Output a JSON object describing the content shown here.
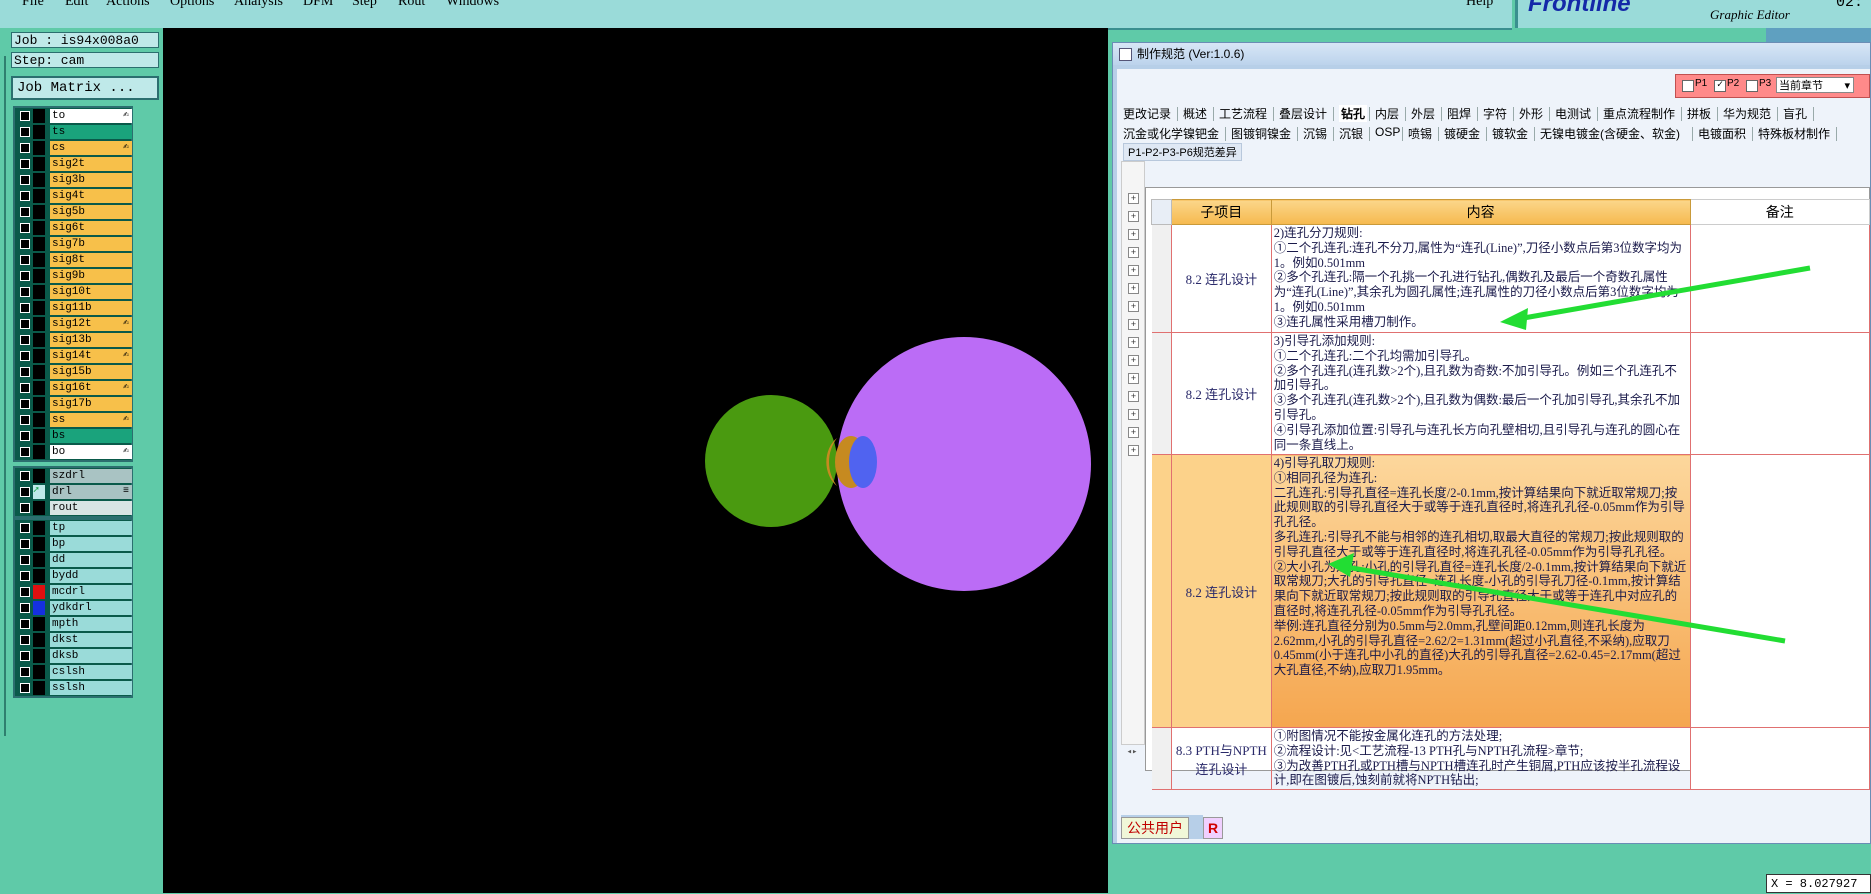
{
  "menu": [
    "File",
    "Edit",
    "Actions",
    "Options",
    "Analysis",
    "DFM",
    "Step",
    "Rout",
    "Windows",
    "Help"
  ],
  "brand": {
    "logo_text": "Frontline",
    "subtitle": "Graphic Editor",
    "clock": "02:"
  },
  "job": {
    "job_label": "Job : is94x008a0",
    "step_label": "Step: cam",
    "matrix_button": "Job Matrix ..."
  },
  "layers_group1": [
    {
      "name": "to",
      "color": "#ffffff",
      "mark": "✍"
    },
    {
      "name": "ts",
      "color": "#1aa37c",
      "mark": ""
    },
    {
      "name": "cs",
      "color": "#f7c04a",
      "mark": "✍"
    },
    {
      "name": "sig2t",
      "color": "#f7c04a",
      "mark": ""
    },
    {
      "name": "sig3b",
      "color": "#f7c04a",
      "mark": ""
    },
    {
      "name": "sig4t",
      "color": "#f7c04a",
      "mark": ""
    },
    {
      "name": "sig5b",
      "color": "#f7c04a",
      "mark": ""
    },
    {
      "name": "sig6t",
      "color": "#f7c04a",
      "mark": ""
    },
    {
      "name": "sig7b",
      "color": "#f7c04a",
      "mark": ""
    },
    {
      "name": "sig8t",
      "color": "#f7c04a",
      "mark": ""
    },
    {
      "name": "sig9b",
      "color": "#f7c04a",
      "mark": ""
    },
    {
      "name": "sig10t",
      "color": "#f7c04a",
      "mark": ""
    },
    {
      "name": "sig11b",
      "color": "#f7c04a",
      "mark": ""
    },
    {
      "name": "sig12t",
      "color": "#f7c04a",
      "mark": "✍"
    },
    {
      "name": "sig13b",
      "color": "#f7c04a",
      "mark": ""
    },
    {
      "name": "sig14t",
      "color": "#f7c04a",
      "mark": "✍"
    },
    {
      "name": "sig15b",
      "color": "#f7c04a",
      "mark": ""
    },
    {
      "name": "sig16t",
      "color": "#f7c04a",
      "mark": "✍"
    },
    {
      "name": "sig17b",
      "color": "#f7c04a",
      "mark": ""
    },
    {
      "name": "ss",
      "color": "#f7c04a",
      "mark": "✍"
    },
    {
      "name": "bs",
      "color": "#1aa37c",
      "mark": ""
    },
    {
      "name": "bo",
      "color": "#ffffff",
      "mark": "✍"
    }
  ],
  "layers_group2": [
    {
      "name": "szdrl",
      "color": "#a9c3c3",
      "mark": ""
    },
    {
      "name": "drl",
      "color": "#a9c3c3",
      "mark": "≡"
    },
    {
      "name": "rout",
      "color": "#d8e4e4",
      "mark": ""
    }
  ],
  "layers_group3": [
    {
      "name": "tp",
      "color": "#9adbd9",
      "mark": ""
    },
    {
      "name": "bp",
      "color": "#9adbd9",
      "mark": ""
    },
    {
      "name": "dd",
      "color": "#9adbd9",
      "mark": ""
    },
    {
      "name": "bydd",
      "color": "#9adbd9",
      "mark": ""
    },
    {
      "name": "mcdrl",
      "color": "#9adbd9",
      "mark": ""
    },
    {
      "name": "ydkdrl",
      "color": "#9adbd9",
      "mark": ""
    },
    {
      "name": "mpth",
      "color": "#9adbd9",
      "mark": ""
    },
    {
      "name": "dkst",
      "color": "#9adbd9",
      "mark": ""
    },
    {
      "name": "dksb",
      "color": "#9adbd9",
      "mark": ""
    },
    {
      "name": "cslsh",
      "color": "#9adbd9",
      "mark": ""
    },
    {
      "name": "sslsh",
      "color": "#9adbd9",
      "mark": ""
    }
  ],
  "canvas_colors": {
    "small_circle": "#4a9a10",
    "big_circle": "#bb6cf6",
    "overlap_small": "#c68a20",
    "overlap_big": "#5063f0"
  },
  "dialog": {
    "title": "制作规范 (Ver:1.0.6)",
    "p1": "P1",
    "p2": "P2",
    "p3": "P3",
    "section_select": "当前章节",
    "tabs_row1": [
      "更改记录",
      "概述",
      "工艺流程",
      "叠层设计",
      "钻孔",
      "内层",
      "外层",
      "阻焊",
      "字符",
      "外形",
      "电测试",
      "重点流程制作",
      "拼板",
      "华为规范",
      "盲孔"
    ],
    "tabs_row2": [
      "沉金或化学镍钯金",
      "图镀铜镍金",
      "沉锡",
      "沉银",
      "OSP",
      "喷锡",
      "镀硬金",
      "镀软金",
      "无镍电镀金(含硬金、软金)",
      "电镀面积",
      "特殊板材制作"
    ],
    "subtab": "P1-P2-P3-P6规范差异",
    "columns": [
      "子项目",
      "内容",
      "备注"
    ],
    "rows": [
      {
        "item": "8.2 连孔设计",
        "content": [
          "2)连孔分刀规则:",
          "①二个孔连孔:连孔不分刀,属性为“连孔(Line)”,刀径小数点后第3位数字均为1。例如0.501mm",
          "②多个孔连孔:隔一个孔挑一个孔进行钻孔,偶数孔及最后一个奇数孔属性为“连孔(Line)”,其余孔为圆孔属性;连孔属性的刀径小数点后第3位数字均为1。例如0.501mm",
          "③连孔属性采用槽刀制作。"
        ],
        "note": ""
      },
      {
        "item": "8.2 连孔设计",
        "content": [
          "3)引导孔添加规则:",
          "①二个孔连孔:二个孔均需加引导孔。",
          "②多个孔连孔(连孔数>2个),且孔数为奇数:不加引导孔。例如三个孔连孔不加引导孔。",
          "③多个孔连孔(连孔数>2个),且孔数为偶数:最后一个孔加引导孔,其余孔不加引导孔。",
          "④引导孔添加位置:引导孔与连孔长方向孔壁相切,且引导孔与连孔的圆心在同一条直线上。"
        ],
        "note": ""
      },
      {
        "item": "8.2 连孔设计",
        "content": [
          "4)引导孔取刀规则:",
          "①相同孔径为连孔:",
          "二孔连孔:引导孔直径=连孔长度/2-0.1mm,按计算结果向下就近取常规刀;按此规则取的引导孔直径大于或等于连孔直径时,将连孔孔径-0.05mm作为引导孔孔径。",
          "多孔连孔:引导孔不能与相邻的连孔相切,取最大直径的常规刀;按此规则取的引导孔直径大于或等于连孔直径时,将连孔孔径-0.05mm作为引导孔孔径。",
          "②大小孔为连孔:小孔的引导孔直径=连孔长度/2-0.1mm,按计算结果向下就近取常规刀;大孔的引导孔直径=连孔长度-小孔的引导孔刀径-0.1mm,按计算结果向下就近取常规刀;按此规则取的引导孔直径大于或等于连孔中对应孔的直径时,将连孔孔径-0.05mm作为引导孔孔径。",
          "举例:连孔直径分别为0.5mm与2.0mm,孔壁间距0.12mm,则连孔长度为2.62mm,小孔的引导孔直径=2.62/2=1.31mm(超过小孔直径,不采纳),应取刀0.45mm(小于连孔中小孔的直径)大孔的引导孔直径=2.62-0.45=2.17mm(超过大孔直径,不纳),应取刀1.95mm。"
        ],
        "note": "",
        "highlight": true
      },
      {
        "item": "8.3 PTH与NPTH连孔设计",
        "content": [
          "①附图情况不能按金属化连孔的方法处理;",
          "②流程设计:见<工艺流程-13 PTH孔与NPTH孔流程>章节;",
          "③为改善PTH孔或PTH槽与NPTH槽连孔时产生铜屑,PTH应该按半孔流程设计,即在图镀后,蚀刻前就将NPTH钻出;"
        ],
        "note": ""
      }
    ],
    "status_user": "公共用户",
    "status_r": "R"
  },
  "coord_readout": "X = 8.027927",
  "arrow_color": "#22dd33"
}
